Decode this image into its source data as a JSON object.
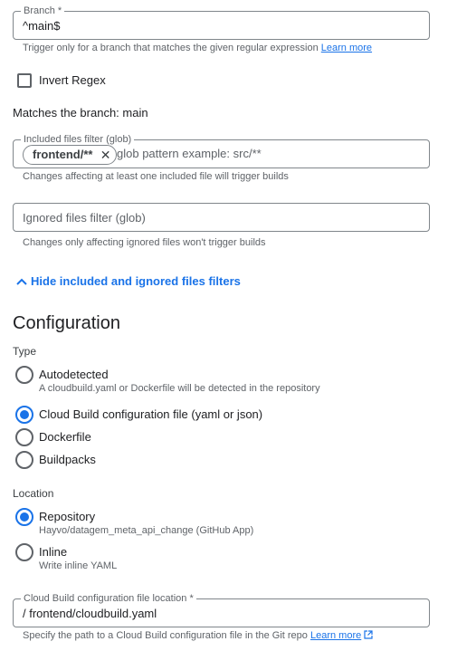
{
  "branch": {
    "label": "Branch *",
    "value": "^main$",
    "hint": "Trigger only for a branch that matches the given regular expression",
    "learn_more": "Learn more"
  },
  "invert_regex": {
    "label": "Invert Regex",
    "checked": false
  },
  "matches_text": "Matches the branch: main",
  "included_filter": {
    "label": "Included files filter (glob)",
    "chip": "frontend/**",
    "placeholder": "glob pattern example: src/**",
    "hint": "Changes affecting at least one included file will trigger builds"
  },
  "ignored_filter": {
    "placeholder": "Ignored files filter (glob)",
    "hint": "Changes only affecting ignored files won't trigger builds"
  },
  "toggle_filters": "Hide included and ignored files filters",
  "configuration": {
    "title": "Configuration",
    "type_label": "Type",
    "types": [
      {
        "label": "Autodetected",
        "desc": "A cloudbuild.yaml or Dockerfile will be detected in the repository",
        "checked": false
      },
      {
        "label": "Cloud Build configuration file (yaml or json)",
        "checked": true
      },
      {
        "label": "Dockerfile",
        "checked": false
      },
      {
        "label": "Buildpacks",
        "checked": false
      }
    ],
    "location_label": "Location",
    "locations": [
      {
        "label": "Repository",
        "desc": "Hayvo/datagem_meta_api_change (GitHub App)",
        "checked": true
      },
      {
        "label": "Inline",
        "desc": "Write inline YAML",
        "checked": false
      }
    ],
    "file_location": {
      "label": "Cloud Build configuration file location *",
      "value": "/ frontend/cloudbuild.yaml",
      "hint": "Specify the path to a Cloud Build configuration file in the Git repo",
      "learn_more": "Learn more"
    }
  },
  "colors": {
    "accent": "#1a73e8",
    "text": "#202124",
    "muted": "#5f6368",
    "border": "#80868b"
  }
}
